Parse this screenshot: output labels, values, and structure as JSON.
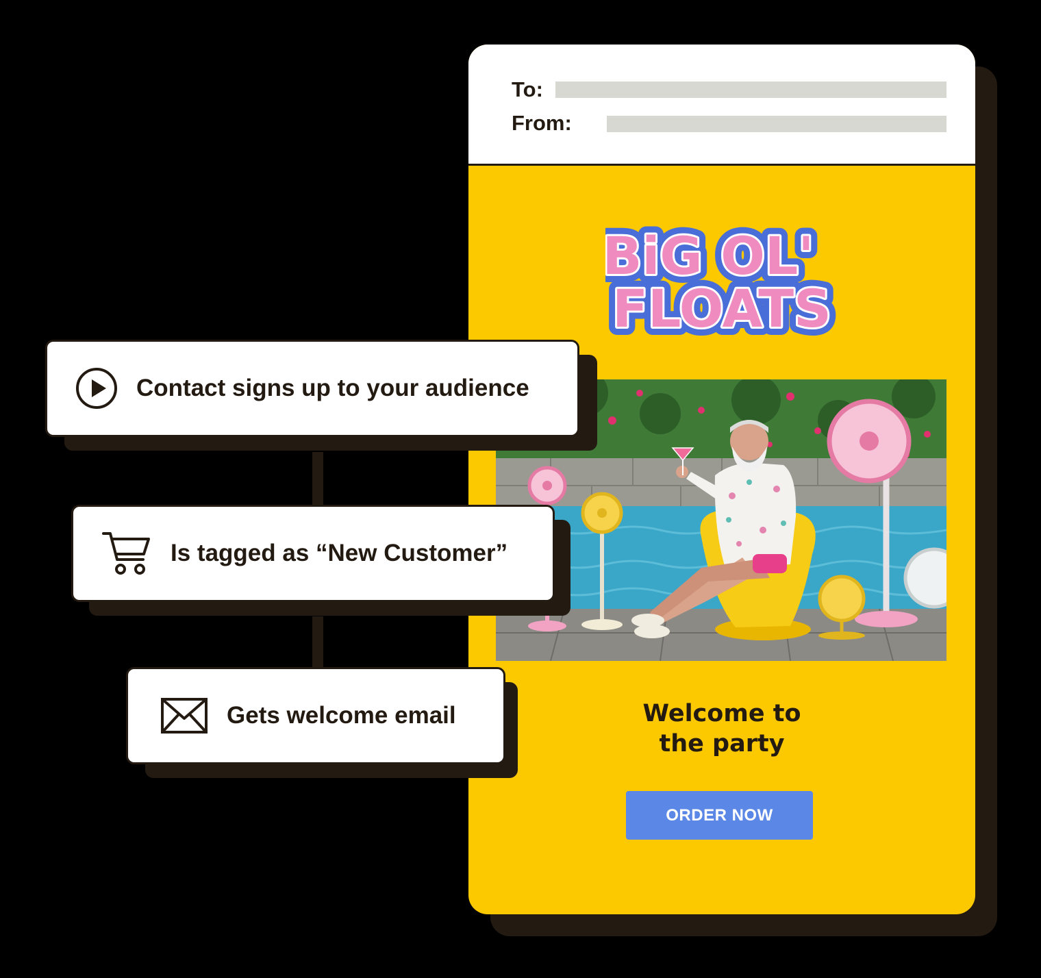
{
  "email": {
    "to_label": "To:",
    "from_label": "From:",
    "brand": {
      "line1": "BiG OL'",
      "line2": "FLOATS"
    },
    "headline_line1": "Welcome to",
    "headline_line2": "the party",
    "cta_label": "ORDER NOW",
    "colors": {
      "background": "#fcc800",
      "cta": "#5b87e6",
      "logo_fill": "#f08bc0",
      "logo_outline": "#4a6ed8"
    }
  },
  "automation": {
    "steps": [
      {
        "icon": "play-circle-icon",
        "label": "Contact signs up to your audience"
      },
      {
        "icon": "shopping-cart-icon",
        "label": "Is tagged as “New Customer”"
      },
      {
        "icon": "envelope-icon",
        "label": "Gets welcome email"
      }
    ]
  }
}
